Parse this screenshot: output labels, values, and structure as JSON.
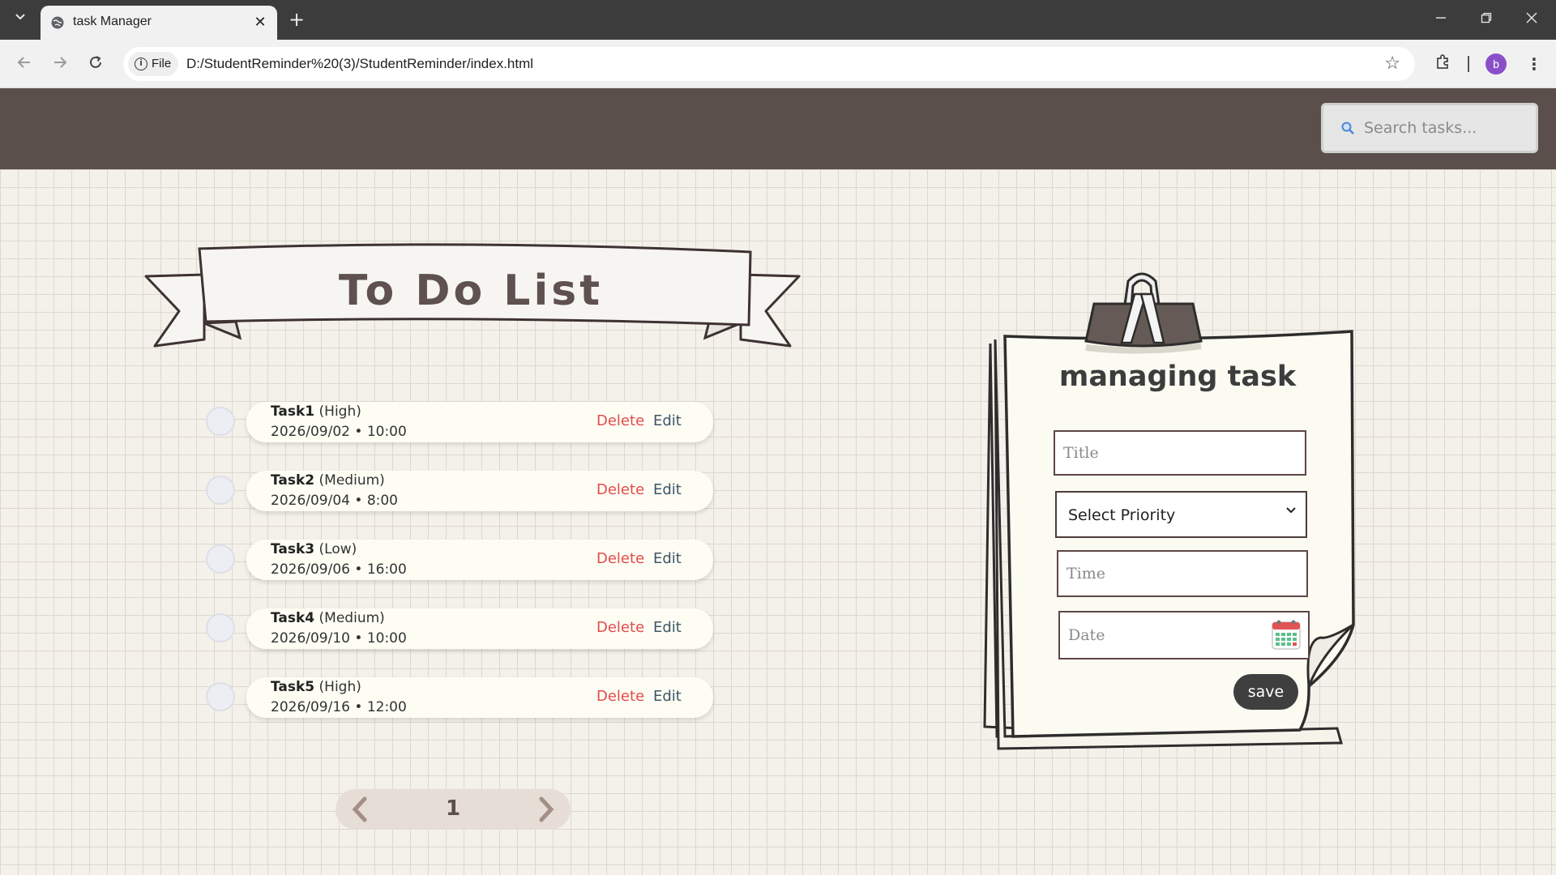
{
  "browser": {
    "tab_title": "task Manager",
    "url_chip": "File",
    "url": "D:/StudentReminder%20(3)/StudentReminder/index.html",
    "profile_initial": "b"
  },
  "header": {
    "search_placeholder": "Search tasks..."
  },
  "todo": {
    "title": "To Do List",
    "delete_label": "Delete",
    "edit_label": "Edit",
    "tasks": [
      {
        "name": "Task1",
        "priority": "(High)",
        "datetime": "2026/09/02 • 10:00"
      },
      {
        "name": "Task2",
        "priority": "(Medium)",
        "datetime": "2026/09/04 • 8:00"
      },
      {
        "name": "Task3",
        "priority": "(Low)",
        "datetime": "2026/09/06 • 16:00"
      },
      {
        "name": "Task4",
        "priority": "(Medium)",
        "datetime": "2026/09/10 • 10:00"
      },
      {
        "name": "Task5",
        "priority": "(High)",
        "datetime": "2026/09/16 • 12:00"
      }
    ],
    "page_number": "1"
  },
  "form": {
    "title": "managing task",
    "title_placeholder": "Title",
    "priority_selected": "Select Priority",
    "time_placeholder": "Time",
    "date_placeholder": "Date",
    "save_label": "save"
  },
  "colors": {
    "header_bg": "#5b4f4b",
    "delete": "#e34b4b",
    "edit": "#3d5568",
    "save_bg": "#3f3f3f"
  }
}
